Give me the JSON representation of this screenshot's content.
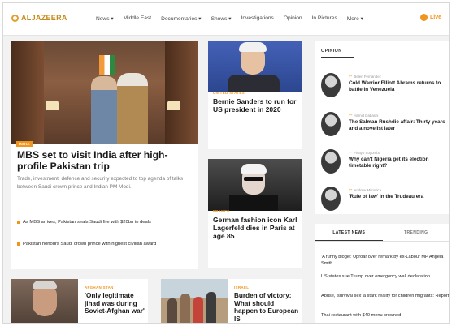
{
  "header": {
    "logo": "ALJAZEERA",
    "nav": [
      "News ▾",
      "Middle East",
      "Documentaries ▾",
      "Shows ▾",
      "Investigations",
      "Opinion",
      "In Pictures",
      "More ▾"
    ],
    "live": "Live"
  },
  "main_story": {
    "tag": "INDIA",
    "title": "MBS set to visit India after high-profile Pakistan trip",
    "summary": "Trade, investment, defence and security expected to top agenda of talks between Saudi crown prince and Indian PM Modi.",
    "related": [
      "As MBS arrives, Pakistan seals Saudi fire with $20bn in deals",
      "Pakistan honours Saudi crown prince with highest civilian award"
    ]
  },
  "middle": [
    {
      "tag": "UNITED STATES",
      "title": "Bernie Sanders to run for US president in 2020"
    },
    {
      "tag": "FRANCE",
      "title": "German fashion icon Karl Lagerfeld dies in Paris at age 85"
    }
  ],
  "opinion": {
    "heading": "OPINION",
    "items": [
      {
        "author": "Belen Fernandez",
        "title": "Cold Warrior Elliott Abrams returns to battle in Venezuela"
      },
      {
        "author": "Hamid Dabashi",
        "title": "The Salman Rushdie affair: Thirty years and a novelist later"
      },
      {
        "author": "Fisayo Soyombo",
        "title": "Why can't Nigeria get its election timetable right?"
      },
      {
        "author": "Andrew Mitrovica",
        "title": "'Rule of law' in the Trudeau era"
      }
    ]
  },
  "latest": {
    "tabs": [
      "LATEST NEWS",
      "TRENDING"
    ],
    "items": [
      "'A funny bloge': Uproar over remark by ex-Labour MP Angela Smith",
      "US states sue Trump over emergency wall declaration",
      "Abuse, 'survival sex' a stark reality for children migrants: Report",
      "Thai restaurant with $40 menu crowned"
    ]
  },
  "bottom": [
    {
      "tag": "AFGHANISTAN",
      "title": "'Only legitimate jihad was during Soviet-Afghan war'"
    },
    {
      "tag": "ISRAEL",
      "title": "Burden of victory: What should happen to European IS"
    }
  ],
  "colors": {
    "accent": "#f0961e",
    "brand": "#c68c1e"
  }
}
